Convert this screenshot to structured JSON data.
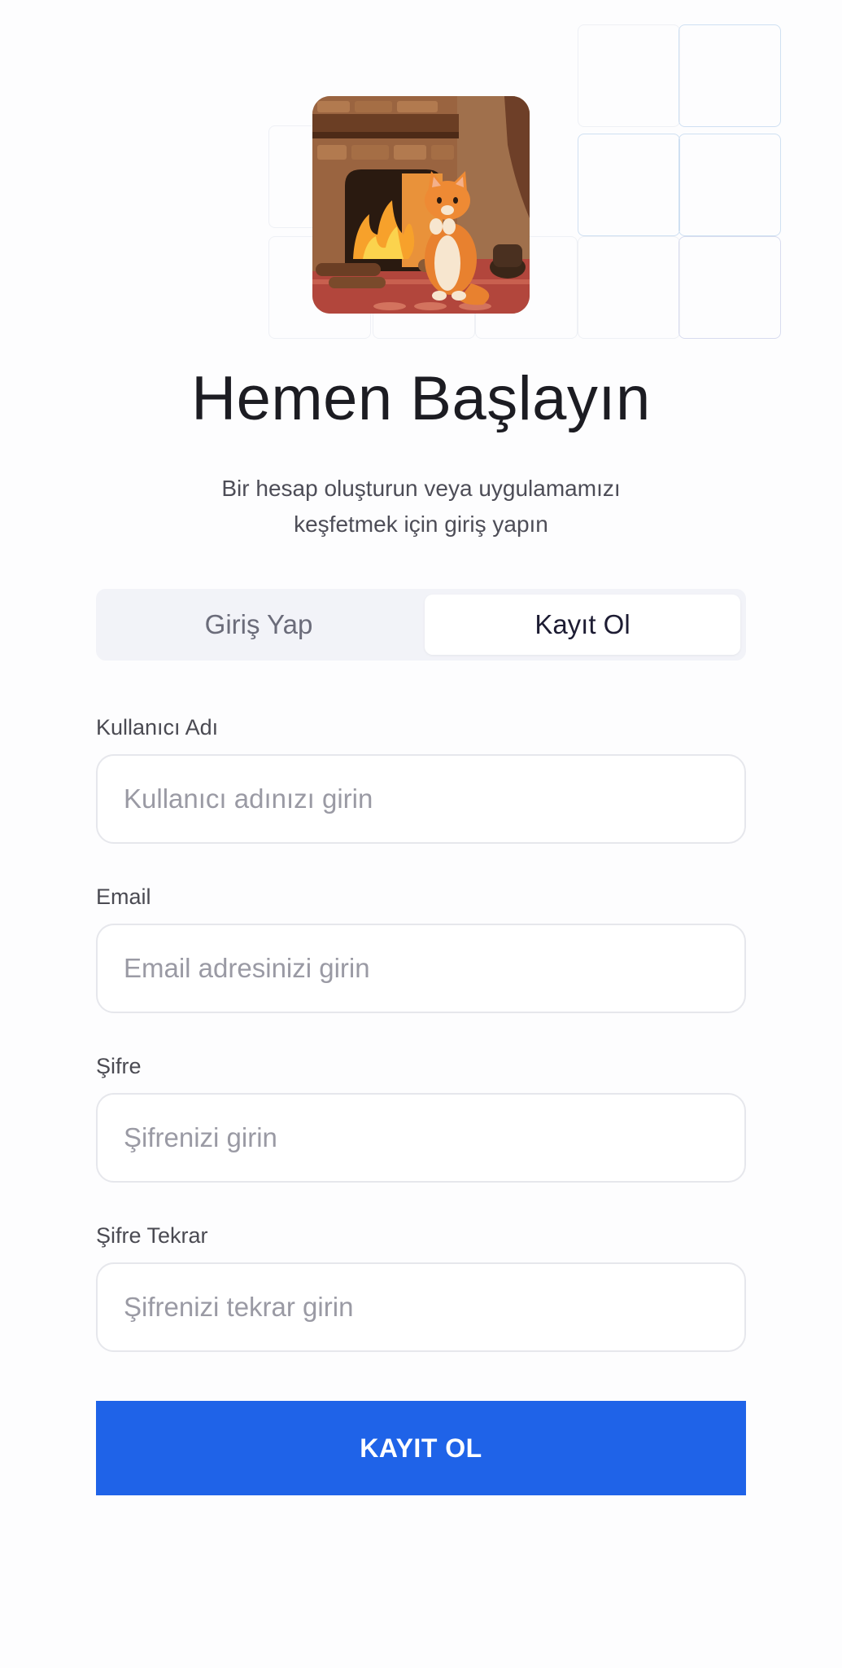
{
  "header": {
    "title": "Hemen Başlayın",
    "subtitle_line1": "Bir hesap oluşturun veya uygulamamızı",
    "subtitle_line2": "keşfetmek için giriş yapın"
  },
  "tabs": {
    "login_label": "Giriş Yap",
    "register_label": "Kayıt Ol",
    "active": "register"
  },
  "form": {
    "username": {
      "label": "Kullanıcı Adı",
      "placeholder": "Kullanıcı adınızı girin",
      "value": ""
    },
    "email": {
      "label": "Email",
      "placeholder": "Email adresinizi girin",
      "value": ""
    },
    "password": {
      "label": "Şifre",
      "placeholder": "Şifrenizi girin",
      "value": ""
    },
    "password_repeat": {
      "label": "Şifre Tekrar",
      "placeholder": "Şifrenizi tekrar girin",
      "value": ""
    },
    "submit_label": "KAYIT OL"
  },
  "colors": {
    "accent": "#1f63e8",
    "tab_bg": "#f2f3f8",
    "title": "#1c1c22"
  },
  "illustration": {
    "icon": "cat-fireplace-illustration"
  }
}
